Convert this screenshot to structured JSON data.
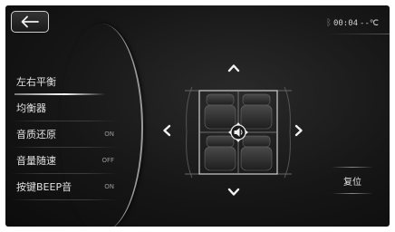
{
  "header": {
    "back_icon": "arrow-left-icon",
    "status_icon": "bluetooth-icon",
    "time": "00:04",
    "temperature": "--℃"
  },
  "menu": {
    "items": [
      {
        "label": "左右平衡",
        "value": ""
      },
      {
        "label": "均衡器",
        "value": ""
      },
      {
        "label": "音质还原",
        "value": "ON"
      },
      {
        "label": "音量随速",
        "value": "OFF"
      },
      {
        "label": "按键BEEP音",
        "value": "ON"
      }
    ],
    "active_index": 0
  },
  "balance": {
    "up_icon": "chevron-up-icon",
    "down_icon": "chevron-down-icon",
    "left_icon": "chevron-left-icon",
    "right_icon": "chevron-right-icon",
    "center_icon": "speaker-icon"
  },
  "reset_label": "复位"
}
